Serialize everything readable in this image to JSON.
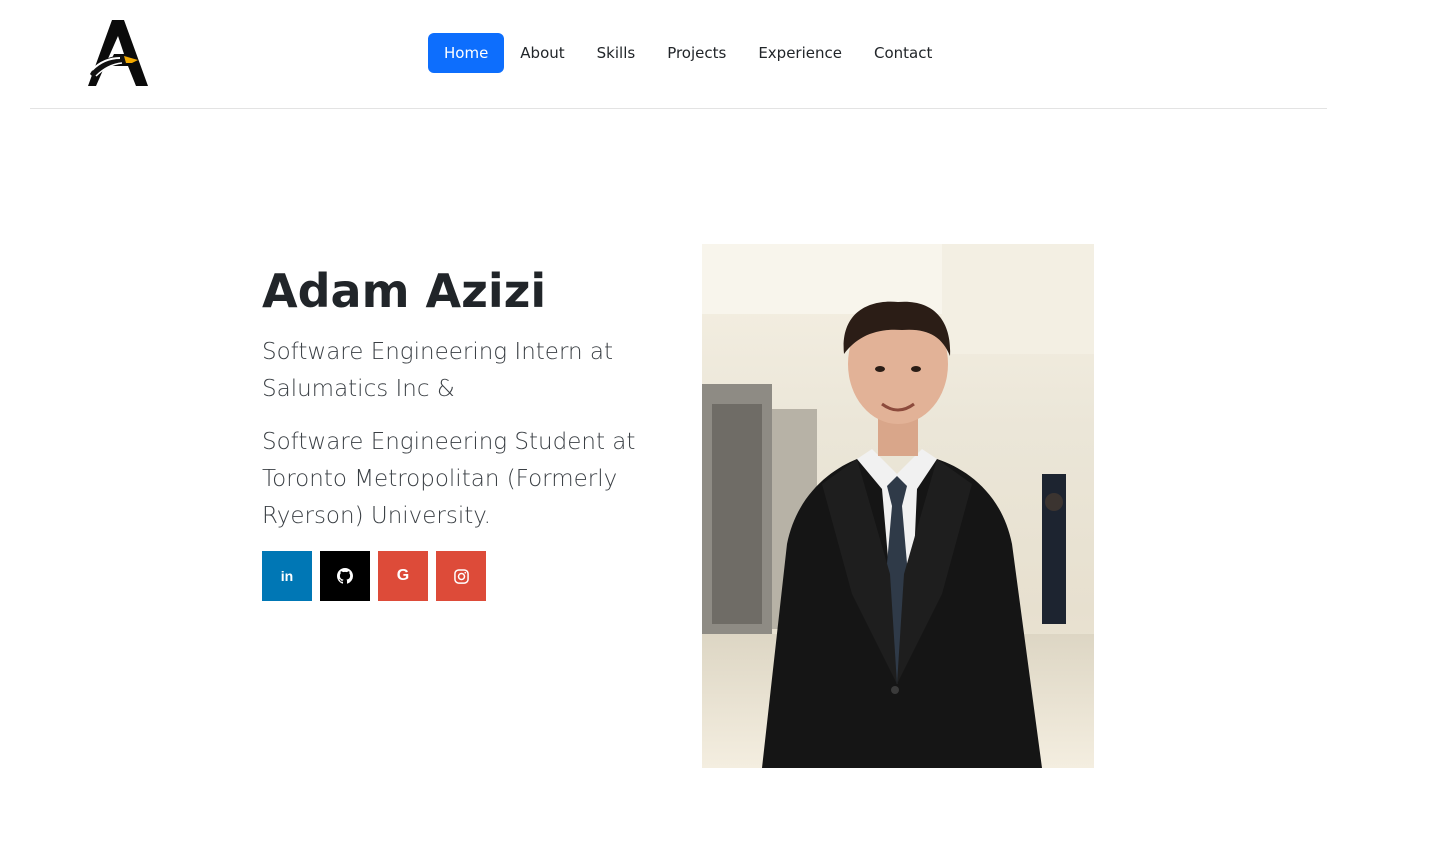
{
  "nav": {
    "items": [
      {
        "label": "Home",
        "active": true
      },
      {
        "label": "About"
      },
      {
        "label": "Skills"
      },
      {
        "label": "Projects"
      },
      {
        "label": "Experience"
      },
      {
        "label": "Contact"
      }
    ],
    "active_color": "#0d6efd"
  },
  "hero": {
    "name": "Adam Azizi",
    "role": "Software Engineering Intern at Salumatics Inc &",
    "school": "Software Engineering Student at Toronto Metropolitan (Formerly Ryerson) University."
  },
  "socials": [
    {
      "icon": "linkedin-icon",
      "glyph": "in",
      "color": "#0077b5"
    },
    {
      "icon": "github-icon",
      "color": "#000000"
    },
    {
      "icon": "google-icon",
      "glyph": "G",
      "color": "#dd4b39"
    },
    {
      "icon": "instagram-icon",
      "color": "#dd4b39"
    }
  ]
}
